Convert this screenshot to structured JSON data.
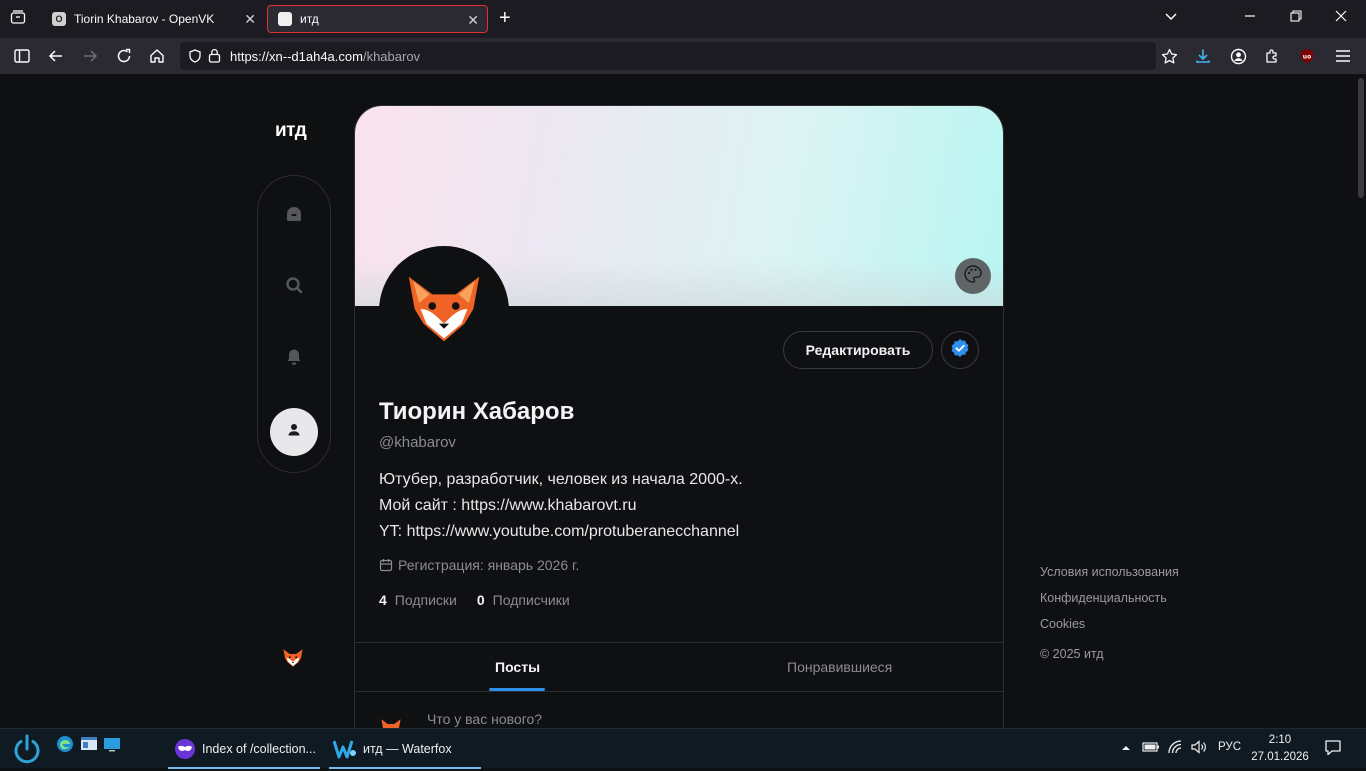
{
  "browser": {
    "tabs": [
      {
        "title": "Tiorin Khabarov - OpenVK",
        "favicon": "O",
        "active": false
      },
      {
        "title": "итд",
        "favicon": "ИТД",
        "active": true
      }
    ],
    "url_host": "https://xn--d1ah4a.com",
    "url_path": "/khabarov"
  },
  "site": {
    "logo": "итд",
    "nav": [
      "home-icon",
      "search-icon",
      "bell-icon",
      "user-icon"
    ]
  },
  "profile": {
    "display_name": "Тиорин Хабаров",
    "handle": "@khabarov",
    "bio": [
      "Ютубер, разработчик, человек из начала 2000-х.",
      "Мой сайт : https://www.khabarovt.ru",
      "YT: https://www.youtube.com/protuberanecchannel"
    ],
    "registration": "Регистрация: январь 2026 г.",
    "following_count": "4",
    "following_label": "Подписки",
    "followers_count": "0",
    "followers_label": "Подписчики",
    "edit_label": "Редактировать",
    "tabs": [
      "Посты",
      "Понравившиеся"
    ],
    "compose_placeholder": "Что у вас нового?"
  },
  "footer": {
    "links": [
      "Условия использования",
      "Конфиденциальность",
      "Cookies"
    ],
    "copyright": "© 2025 итд"
  },
  "taskbar": {
    "tasks": [
      "Index of /collection...",
      "итд — Waterfox"
    ],
    "language": "РУС",
    "time": "2:10",
    "date": "27.01.2026"
  },
  "colors": {
    "accent": "#2f8ee8",
    "background": "#0f1012",
    "active_tab_border": "#e03030"
  }
}
